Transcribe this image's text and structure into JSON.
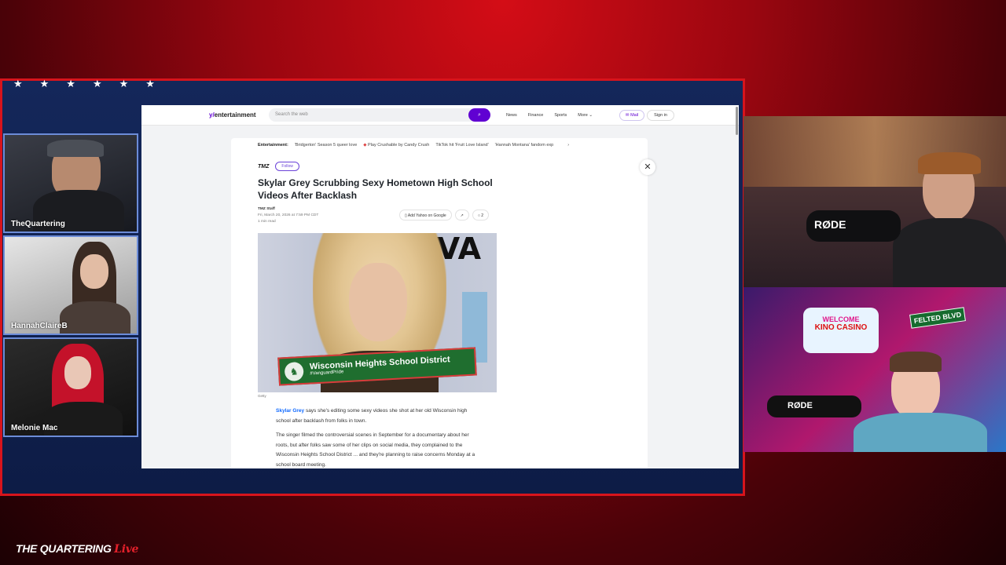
{
  "stream": {
    "brand_main": "THE QUARTERING",
    "brand_live": "Live"
  },
  "cams": [
    {
      "name": "TheQuartering"
    },
    {
      "name": "HannahClaireB"
    },
    {
      "name": "Melonie Mac"
    }
  ],
  "right_cams": {
    "mic_label_1": "RØDE",
    "mic_label_2": "RØDE",
    "sign_welcome": "WELCOME",
    "sign_casino": "KINO CASINO",
    "sign_street": "FELTED BLVD"
  },
  "yahoo": {
    "logo_y": "y/",
    "logo_text": "entertainment",
    "search_placeholder": "Search the web",
    "nav": [
      "News",
      "Finance",
      "Sports",
      "More"
    ],
    "mail": "Mail",
    "signin": "Sign in"
  },
  "trending": {
    "label": "Entertainment:",
    "items": [
      "'Bridgerton' Season 5 queer love",
      "Play Crushable by Candy Crush",
      "TikTok hit 'Fruit Love Island'",
      "'Hannah Montana' fandom exp"
    ]
  },
  "article": {
    "publisher": "TMZ",
    "follow": "Follow",
    "headline": "Skylar Grey Scrubbing Sexy Hometown High School Videos After Backlash",
    "author": "TMZ Staff",
    "date": "Fri, March 20, 2026 at 7:59 PM CDT",
    "read_time": "1 min read",
    "add_source": "Add Yahoo on Google",
    "comments": "2",
    "photo_credit": "Getty",
    "banner_title": "Wisconsin Heights School District",
    "banner_tag": "#VanguardPride",
    "photo_letters": "VA",
    "p1_link": "Skylar Grey",
    "p1_rest": " says she's editing some sexy videos she shot at her old Wisconsin high school after backlash from folks in town.",
    "p2": "The singer filmed the controversial scenes in September for a documentary about her roots, but after folks saw some of her clips on social media, they complained to the Wisconsin Heights School District ... and they're planning to raise concerns Monday at a school board meeting."
  },
  "colors": {
    "accent": "#6001d2",
    "stream_red": "#d7141c",
    "stream_blue": "#14275a"
  }
}
